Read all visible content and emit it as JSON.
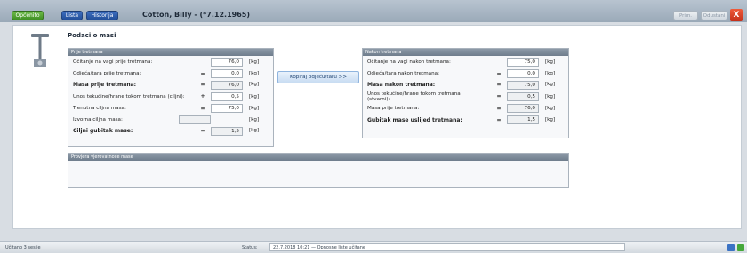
{
  "header": {
    "tabs": [
      {
        "label": "Općenito",
        "color": "#4fa52e"
      },
      {
        "label": "Lista",
        "color": "#2d5fae"
      },
      {
        "label": "Historija",
        "color": "#2d5fae"
      }
    ],
    "patient": "Cotton, Billy - (*7.12.1965)",
    "prim_label": "Prim.",
    "odustani_label": "Odustani",
    "close_glyph": "X"
  },
  "page": {
    "icon": "scale-icon",
    "title": "Podaci o masi"
  },
  "before": {
    "title": "Prije tretmana",
    "rows": [
      {
        "label": "Očitanje na vagi prije tretmana:",
        "op": "",
        "value": "76,0",
        "unit": "[kg]",
        "bold": false
      },
      {
        "label": "Odjeća/tara prije tretmana:",
        "op": "=",
        "value": "0,0",
        "unit": "[kg]",
        "bold": false
      },
      {
        "label": "Masa prije tretmana:",
        "op": "=",
        "value": "76,0",
        "unit": "[kg]",
        "bold": true
      },
      {
        "label": "Unos tekućine/hrane tokom tretmana (ciljni):",
        "op": "+",
        "value": "0,5",
        "unit": "[kg]",
        "bold": false
      },
      {
        "label": "Trenutna ciljna masa:",
        "op": "=",
        "value": "75,0",
        "unit": "[kg]",
        "bold": false
      },
      {
        "label": "Izvorna ciljna masa:",
        "op": "",
        "value": "",
        "unit": "[kg]",
        "bold": false
      },
      {
        "label": "Ciljni gubitak mase:",
        "op": "=",
        "value": "1,5",
        "unit": "[kg]",
        "bold": true
      }
    ]
  },
  "copy_button": "Kopiraj odjeću/taru >>",
  "after": {
    "title": "Nakon tretmana",
    "rows": [
      {
        "label": "Očitanje na vagi nakon tretmana:",
        "op": "",
        "value": "75,0",
        "unit": "[kg]",
        "bold": false
      },
      {
        "label": "Odjeća/tara nakon tretmana:",
        "op": "=",
        "value": "0,0",
        "unit": "[kg]",
        "bold": false
      },
      {
        "label": "Masa nakon tretmana:",
        "op": "=",
        "value": "75,0",
        "unit": "[kg]",
        "bold": true
      },
      {
        "label": "Unos tekućine/hrane tokom tretmana (stvarni):",
        "op": "=",
        "value": "0,5",
        "unit": "[kg]",
        "bold": false
      },
      {
        "label": "Masa prije tretmana:",
        "op": "=",
        "value": "76,0",
        "unit": "[kg]",
        "bold": false
      },
      {
        "label": "Gubitak mase uslijed tretmana:",
        "op": "=",
        "value": "1,5",
        "unit": "[kg]",
        "bold": true
      }
    ]
  },
  "check": {
    "title": "Provjera vjerovatnoće mase"
  },
  "statusbar": {
    "left": "Učitano 3 sesije",
    "status_label": "Status:",
    "status_text": "22.7.2018 10:21 — Opnosne liste učitane"
  }
}
